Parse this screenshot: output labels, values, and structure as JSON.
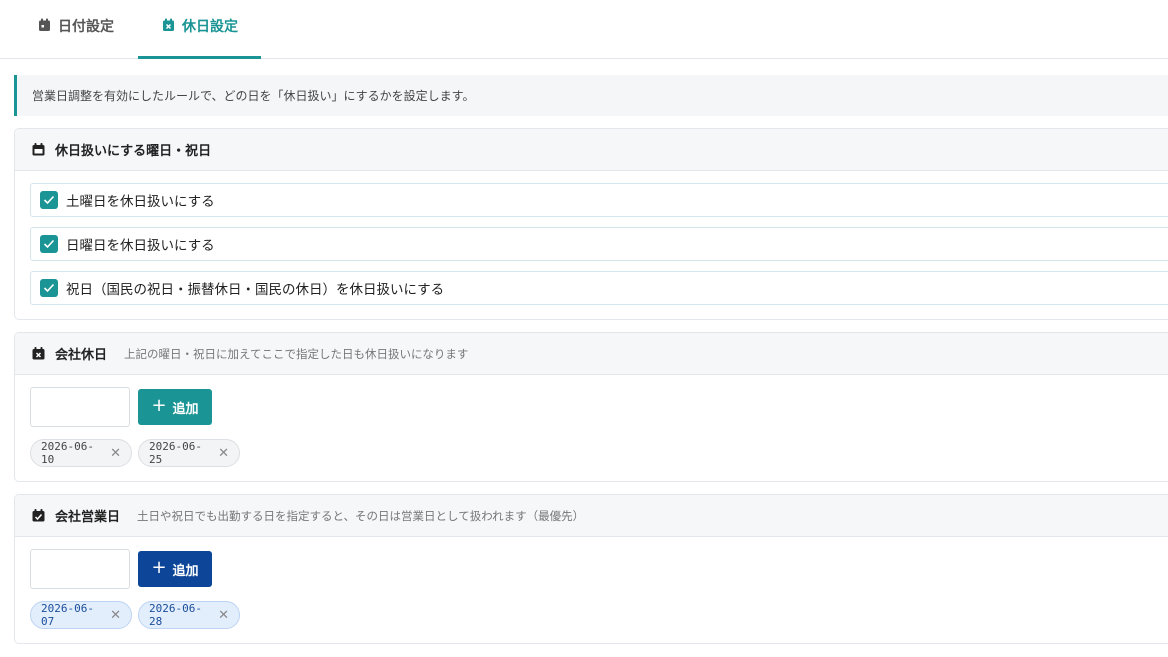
{
  "tabs": {
    "date_label": "日付設定",
    "holiday_label": "休日設定",
    "active": "holiday"
  },
  "notice": "営業日調整を有効にしたルールで、どの日を「休日扱い」にするかを設定します。",
  "weekday_panel": {
    "title": "休日扱いにする曜日・祝日",
    "options": [
      {
        "label": "土曜日を休日扱いにする",
        "checked": true
      },
      {
        "label": "日曜日を休日扱いにする",
        "checked": true
      },
      {
        "label": "祝日（国民の祝日・振替休日・国民の休日）を休日扱いにする",
        "checked": true
      }
    ]
  },
  "company_holiday_panel": {
    "title": "会社休日",
    "subtitle": "上記の曜日・祝日に加えてここで指定した日も休日扱いになります",
    "date_value": "",
    "add_label": "追加",
    "dates": [
      "2026-06-10",
      "2026-06-25"
    ],
    "remove_glyph": "✕"
  },
  "company_workday_panel": {
    "title": "会社営業日",
    "subtitle": "土日や祝日でも出勤する日を指定すると、その日は営業日として扱われます（最優先）",
    "date_value": "",
    "add_label": "追加",
    "dates": [
      "2026-06-07",
      "2026-06-28"
    ],
    "remove_glyph": "✕"
  },
  "colors": {
    "accent_teal": "#1a9494",
    "accent_navy": "#0d4599",
    "chip_blue_bg": "#e3eefc"
  }
}
